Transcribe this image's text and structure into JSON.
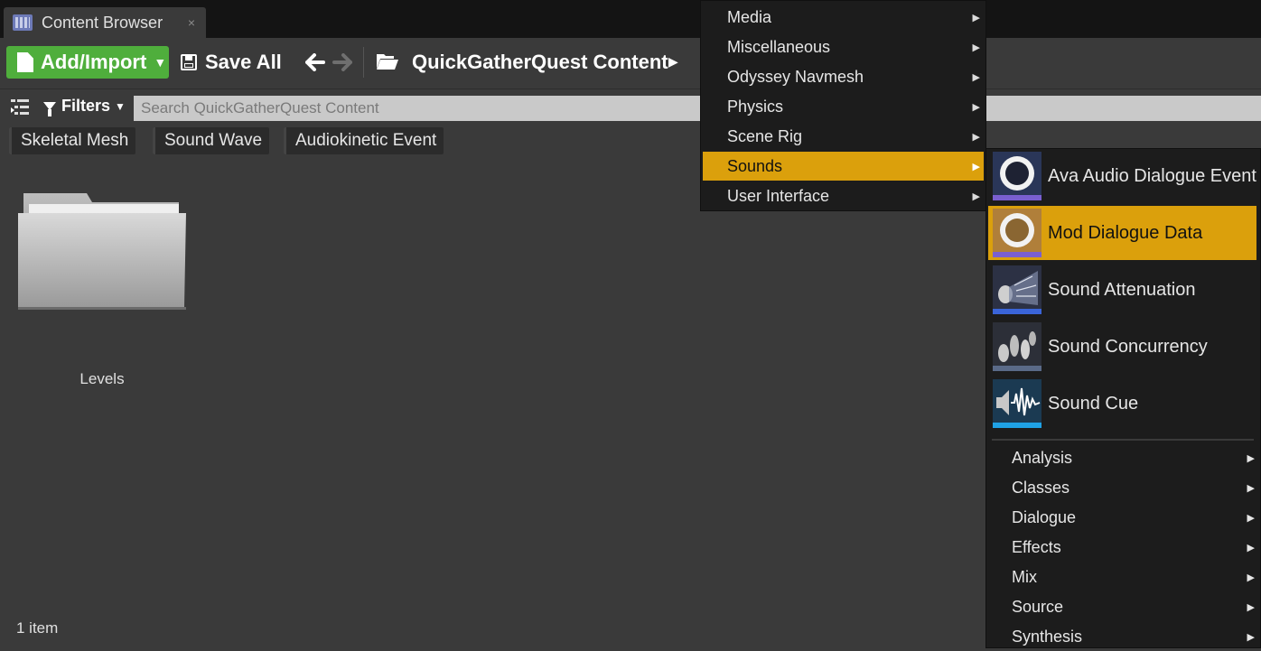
{
  "tab": {
    "title": "Content Browser",
    "close": "×"
  },
  "toolbar": {
    "add_import": "Add/Import",
    "save_all": "Save All",
    "path": "QuickGatherQuest Content",
    "back_glyph": "🡐",
    "forward_glyph": "🡒"
  },
  "filters": {
    "label": "Filters",
    "search_placeholder": "Search QuickGatherQuest Content",
    "chips": [
      "Skeletal Mesh",
      "Sound Wave",
      "Audiokinetic Event"
    ]
  },
  "content": {
    "folders": [
      {
        "name": "Levels"
      }
    ],
    "item_count": "1 item"
  },
  "menu_categories": {
    "items": [
      {
        "label": "Media"
      },
      {
        "label": "Miscellaneous"
      },
      {
        "label": "Odyssey Navmesh"
      },
      {
        "label": "Physics"
      },
      {
        "label": "Scene Rig"
      },
      {
        "label": "Sounds",
        "selected": true
      },
      {
        "label": "User Interface"
      }
    ]
  },
  "menu_sounds": {
    "assets": [
      {
        "label": "Ava Audio Dialogue Event",
        "icon": "dialogue-ring-icon",
        "accent": "#7a5fd0"
      },
      {
        "label": "Mod Dialogue Data",
        "icon": "dialogue-ring-icon",
        "accent": "#7a5fd0",
        "selected": true
      },
      {
        "label": "Sound Attenuation",
        "icon": "speaker-cone-icon",
        "accent": "#3a64d8"
      },
      {
        "label": "Sound Concurrency",
        "icon": "speakers-group-icon",
        "accent": "#5a6a88"
      },
      {
        "label": "Sound Cue",
        "icon": "speaker-wave-icon",
        "accent": "#1fa2e6"
      }
    ],
    "submenus": [
      {
        "label": "Analysis"
      },
      {
        "label": "Classes"
      },
      {
        "label": "Dialogue"
      },
      {
        "label": "Effects"
      },
      {
        "label": "Mix"
      },
      {
        "label": "Source"
      },
      {
        "label": "Synthesis"
      }
    ]
  },
  "colors": {
    "accent_green": "#4fae3c",
    "highlight": "#dba00c",
    "panel": "#3a3a3a",
    "menu_bg": "#1c1c1c"
  }
}
